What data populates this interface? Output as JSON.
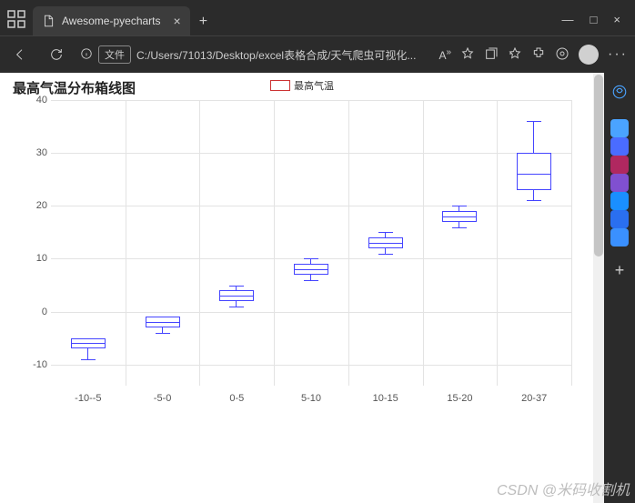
{
  "window": {
    "tab_title": "Awesome-pyecharts",
    "url_badge": "文件",
    "url_text": "C:/Users/71013/Desktop/excel表格合成/天气爬虫可视化...",
    "min": "—",
    "max": "□",
    "close": "×",
    "newtab": "+"
  },
  "toolbar": {
    "read_aloud": "A",
    "read_sup": "»"
  },
  "chart_data": {
    "type": "boxplot",
    "title": "最高气温分布箱线图",
    "legend": "最高气温",
    "ylim": [
      -14,
      40
    ],
    "yticks": [
      -10,
      0,
      10,
      20,
      30,
      40
    ],
    "categories": [
      "-10--5",
      "-5-0",
      "0-5",
      "5-10",
      "10-15",
      "15-20",
      "20-37"
    ],
    "series": [
      {
        "low": -9,
        "q1": -7,
        "median": -6,
        "q3": -5,
        "high": -5
      },
      {
        "low": -4,
        "q1": -3,
        "median": -2,
        "q3": -1,
        "high": -1
      },
      {
        "low": 1,
        "q1": 2,
        "median": 3,
        "q3": 4,
        "high": 5
      },
      {
        "low": 6,
        "q1": 7,
        "median": 8,
        "q3": 9,
        "high": 10
      },
      {
        "low": 11,
        "q1": 12,
        "median": 13,
        "q3": 14,
        "high": 15
      },
      {
        "low": 16,
        "q1": 17,
        "median": 18,
        "q3": 19,
        "high": 20
      },
      {
        "low": 21,
        "q1": 23,
        "median": 26,
        "q3": 30,
        "high": 36
      }
    ]
  },
  "watermark": "CSDN @米码收割机",
  "sidebar_colors": [
    "#4aa3ff",
    "#4a6cff",
    "#b02860",
    "#8050d0",
    "#1a8fff",
    "#2a6ff0",
    "#3a90ff"
  ],
  "sidebar_plus": "+"
}
